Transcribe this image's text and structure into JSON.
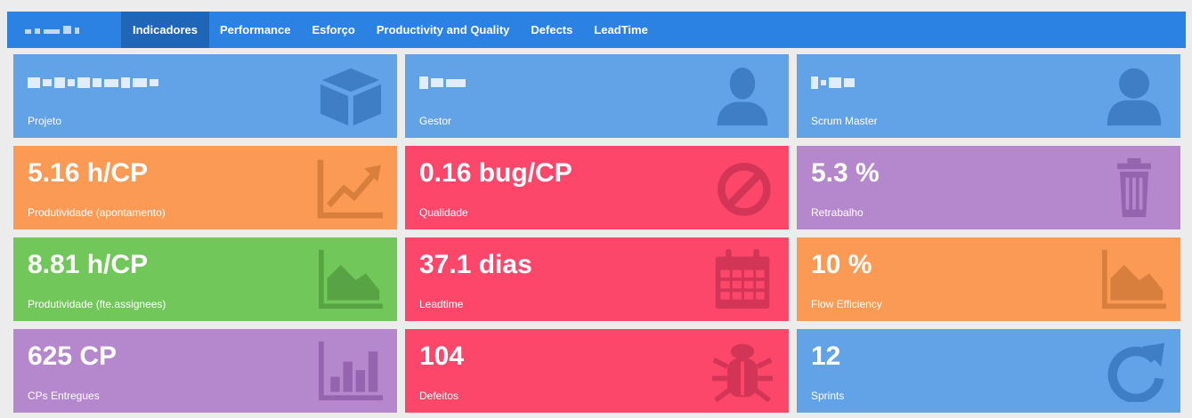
{
  "nav": {
    "items": [
      "Indicadores",
      "Performance",
      "Esforço",
      "Productivity and Quality",
      "Defects",
      "LeadTime"
    ],
    "active": "Indicadores"
  },
  "cards": {
    "projeto": {
      "label": "Projeto",
      "icon": "cube-icon",
      "color": "#62a2e6"
    },
    "gestor": {
      "label": "Gestor",
      "icon": "user-icon",
      "color": "#62a2e6"
    },
    "scrum": {
      "label": "Scrum Master",
      "icon": "user-icon",
      "color": "#62a2e6"
    },
    "produtividade_apont": {
      "value": "5.16 h/CP",
      "label": "Produtividade (apontamento)",
      "icon": "trend-up-chart-icon",
      "color": "#fb9a55"
    },
    "qualidade": {
      "value": "0.16 bug/CP",
      "label": "Qualidade",
      "icon": "ban-icon",
      "color": "#fc476b"
    },
    "retrabalho": {
      "value": "5.3 %",
      "label": "Retrabalho",
      "icon": "trash-icon",
      "color": "#b587cd"
    },
    "produtividade_fte": {
      "value": "8.81 h/CP",
      "label": "Produtividade (fte.assignees)",
      "icon": "area-chart-icon",
      "color": "#72c75a"
    },
    "leadtime": {
      "value": "37.1 dias",
      "label": "Leadtime",
      "icon": "calendar-icon",
      "color": "#fc476b"
    },
    "flow": {
      "value": "10 %",
      "label": "Flow Efficiency",
      "icon": "area-chart-icon",
      "color": "#fb9a55"
    },
    "cps": {
      "value": "625 CP",
      "label": "CPs Entregues",
      "icon": "bar-chart-icon",
      "color": "#b587cd"
    },
    "defeitos": {
      "value": "104",
      "label": "Defeitos",
      "icon": "bug-icon",
      "color": "#fc476b"
    },
    "sprints": {
      "value": "12",
      "label": "Sprints",
      "icon": "refresh-icon",
      "color": "#62a2e6"
    }
  }
}
